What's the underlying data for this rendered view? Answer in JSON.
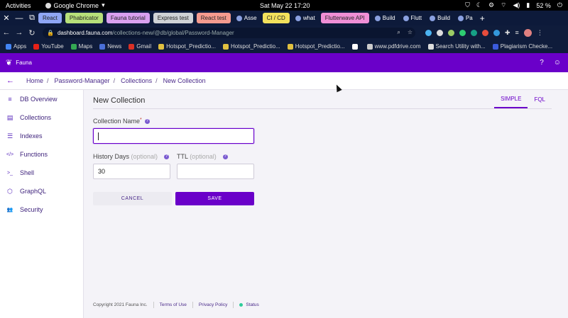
{
  "os": {
    "activities": "Activities",
    "app": "Google Chrome",
    "clock": "Sat May 22  17:20",
    "battery": "52 %"
  },
  "tabs": [
    {
      "label": "React",
      "color": "#8fa6f5"
    },
    {
      "label": "Phabricator",
      "color": "#b7e07a"
    },
    {
      "label": "Fauna tutorial",
      "color": "#d9a0f0"
    },
    {
      "label": "Express test",
      "color": "#cfd2d6"
    },
    {
      "label": "React test",
      "color": "#f59b8f"
    },
    {
      "label": "Asse",
      "color": ""
    },
    {
      "label": "CI / CD",
      "color": "#f2e15c"
    },
    {
      "label": "what",
      "color": ""
    },
    {
      "label": "Flutterwave API",
      "color": "#f08fd6"
    },
    {
      "label": "Build",
      "color": ""
    },
    {
      "label": "Flutt",
      "color": ""
    },
    {
      "label": "Build",
      "color": ""
    },
    {
      "label": "Pa",
      "color": ""
    }
  ],
  "address": {
    "host": "dashboard.fauna.com",
    "path": "/collections-new/@db/global/Password-Manager"
  },
  "bookmarks": [
    "Apps",
    "YouTube",
    "Maps",
    "News",
    "Gmail",
    "Hotspot_Predictio...",
    "Hotspot_Predictio...",
    "Hotspot_Predictio...",
    "",
    "www.pdfdrive.com",
    "Search Utility with...",
    "Plagiarism Checke..."
  ],
  "fauna": {
    "brand": "Fauna"
  },
  "breadcrumb": [
    "Home",
    "Password-Manager",
    "Collections",
    "New Collection"
  ],
  "sidebar": [
    {
      "label": "DB Overview",
      "icon": "database-icon",
      "glyph": "≡"
    },
    {
      "label": "Collections",
      "icon": "collections-icon",
      "glyph": "▤"
    },
    {
      "label": "Indexes",
      "icon": "indexes-icon",
      "glyph": "☰"
    },
    {
      "label": "Functions",
      "icon": "functions-icon",
      "glyph": "</>"
    },
    {
      "label": "Shell",
      "icon": "shell-icon",
      "glyph": ">_"
    },
    {
      "label": "GraphQL",
      "icon": "graphql-icon",
      "glyph": "⬡"
    },
    {
      "label": "Security",
      "icon": "security-icon",
      "glyph": "👥"
    }
  ],
  "main": {
    "title": "New Collection",
    "modes": [
      "SIMPLE",
      "FQL"
    ],
    "collection_name_label": "Collection Name",
    "collection_name_value": "",
    "history_label": "History Days",
    "history_opt": "(optional)",
    "history_value": "30",
    "ttl_label": "TTL",
    "ttl_opt": "(optional)",
    "ttl_value": "",
    "cancel": "CANCEL",
    "save": "SAVE"
  },
  "footer": {
    "copyright": "Copyright 2021 Fauna Inc.",
    "terms": "Terms of Use",
    "privacy": "Privacy Policy",
    "status": "Status"
  }
}
